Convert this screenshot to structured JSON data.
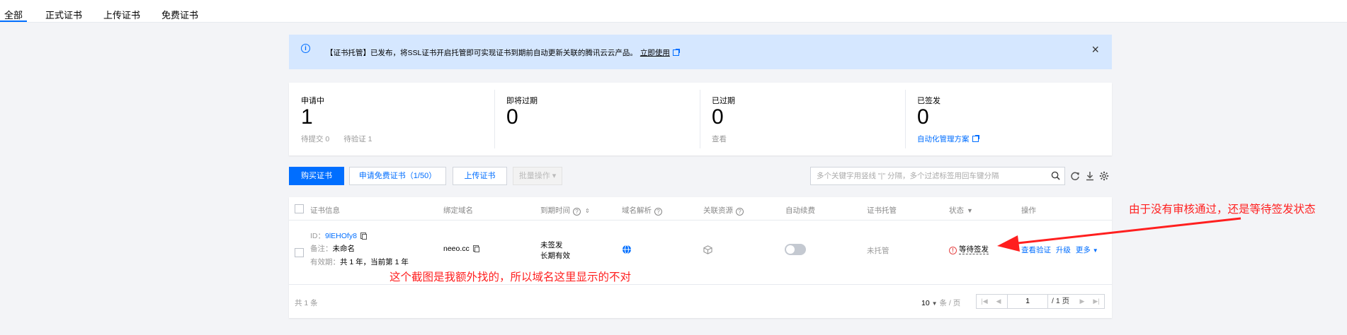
{
  "tabs": [
    {
      "label": "全部",
      "active": true
    },
    {
      "label": "正式证书",
      "active": false
    },
    {
      "label": "上传证书",
      "active": false
    },
    {
      "label": "免费证书",
      "active": false
    }
  ],
  "banner": {
    "icon": "info-icon",
    "text": "【证书托管】已发布，将SSL证书开启托管即可实现证书到期前自动更新关联的腾讯云云产品。",
    "link": "立即使用",
    "close": "×"
  },
  "stats": [
    {
      "label": "申请中",
      "value": "1",
      "subs": [
        "待提交 0",
        "待验证 1"
      ]
    },
    {
      "label": "即将过期",
      "value": "0",
      "subs": []
    },
    {
      "label": "已过期",
      "value": "0",
      "subs": [
        "查看"
      ]
    },
    {
      "label": "已签发",
      "value": "0",
      "link": "自动化管理方案"
    }
  ],
  "toolbar": {
    "buy": "购买证书",
    "apply_free": "申请免费证书（1/50）",
    "upload": "上传证书",
    "batch": "批量操作 ▾",
    "search_placeholder": "多个关键字用竖线 \"|\" 分隔，多个过滤标签用回车键分隔"
  },
  "table": {
    "headers": [
      "证书信息",
      "绑定域名",
      "到期时间",
      "域名解析",
      "关联资源",
      "自动续费",
      "证书托管",
      "状态",
      "操作"
    ],
    "row": {
      "id_label": "ID：",
      "id": "9lEHOfy8",
      "note_label": "备注：",
      "note": "未命名",
      "validity_label": "有效期：",
      "validity": "共 1 年，当前第 1 年",
      "domain": "neeo.cc",
      "expiry_1": "未签发",
      "expiry_2": "长期有效",
      "hosting": "未托管",
      "status": "等待签发",
      "actions": [
        "查看验证",
        "升级",
        "更多"
      ]
    },
    "footer": {
      "total": "共 1 条",
      "page_size": "10",
      "page_size_unit": "条 / 页",
      "page": "1",
      "page_total": "/ 1 页"
    }
  },
  "annotations": {
    "status_note": "由于没有审核通过，还是等待签发状态",
    "domain_note": "这个截图是我额外找的，所以域名这里显示的不对"
  },
  "colors": {
    "accent": "#006eff",
    "annotation": "#ff1f1f",
    "status_error": "#e54545"
  }
}
